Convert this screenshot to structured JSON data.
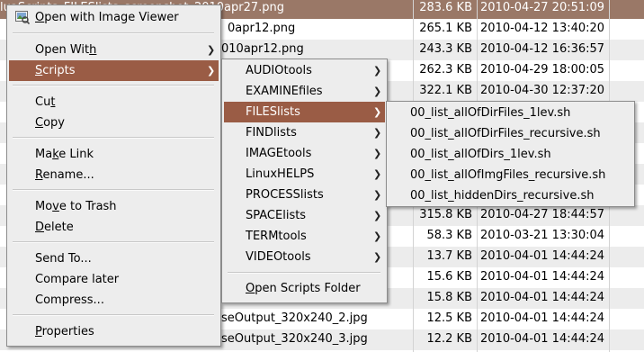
{
  "file_list": {
    "rows": [
      {
        "name": "luaScripts_FILESlists_screenshot_2010apr27.png",
        "size": "283.6 KB",
        "date": "2010-04-27 20:51:09"
      },
      {
        "name": "0apr12.png",
        "size": "265.1 KB",
        "date": "2010-04-12 13:40:20"
      },
      {
        "name": "010apr12.png",
        "size": "243.3 KB",
        "date": "2010-04-12 16:36:57"
      },
      {
        "name": "",
        "size": "262.3 KB",
        "date": "2010-04-29 18:00:05"
      },
      {
        "name": "",
        "size": "322.1 KB",
        "date": "2010-04-30 12:37:20"
      },
      {
        "name": "",
        "size": "",
        "date": ""
      },
      {
        "name": "",
        "size": "",
        "date": ""
      },
      {
        "name": "",
        "size": "",
        "date": ""
      },
      {
        "name": "",
        "size": "",
        "date": ""
      },
      {
        "name": "",
        "size": "",
        "date": ""
      },
      {
        "name": "",
        "size": "315.8 KB",
        "date": "2010-04-27 18:44:57"
      },
      {
        "name": "",
        "size": "58.3 KB",
        "date": "2010-03-21 13:30:04"
      },
      {
        "name": "",
        "size": "13.7 KB",
        "date": "2010-04-01 14:44:24"
      },
      {
        "name": "",
        "size": "15.6 KB",
        "date": "2010-04-01 14:44:24"
      },
      {
        "name": "",
        "size": "15.8 KB",
        "date": "2010-04-01 14:44:24"
      },
      {
        "name": "seOutput_320x240_2.jpg",
        "size": "12.5 KB",
        "date": "2010-04-01 14:44:24"
      },
      {
        "name": "seOutput_320x240_3.jpg",
        "size": "12.2 KB",
        "date": "2010-04-01 14:44:24"
      }
    ]
  },
  "context_menu": {
    "open_with_viewer": {
      "pre": "",
      "ul": "O",
      "post": "pen with Image Viewer"
    },
    "open_with": {
      "pre": "Open Wit",
      "ul": "h",
      "post": ""
    },
    "scripts": {
      "pre": "",
      "ul": "S",
      "post": "cripts"
    },
    "cut": {
      "pre": "Cu",
      "ul": "t",
      "post": ""
    },
    "copy": {
      "pre": "",
      "ul": "C",
      "post": "opy"
    },
    "make_link": {
      "pre": "Ma",
      "ul": "k",
      "post": "e Link"
    },
    "rename": {
      "pre": "",
      "ul": "R",
      "post": "ename..."
    },
    "move_to_trash": {
      "pre": "Mo",
      "ul": "v",
      "post": "e to Trash"
    },
    "delete": {
      "pre": "",
      "ul": "D",
      "post": "elete"
    },
    "send_to": "Send To...",
    "compare_later": "Compare later",
    "compress": "Compress...",
    "properties": {
      "pre": "",
      "ul": "P",
      "post": "roperties"
    }
  },
  "scripts_menu": {
    "items": [
      "AUDIOtools",
      "EXAMINEfiles",
      "FILESlists",
      "FINDlists",
      "IMAGEtools",
      "LinuxHELPS",
      "PROCESSlists",
      "SPACElists",
      "TERMtools",
      "VIDEOtools"
    ],
    "open_folder": {
      "pre": "",
      "ul": "O",
      "post": "pen Scripts Folder"
    }
  },
  "fileslists_menu": {
    "items": [
      "00_list_allOfDirFiles_1lev.sh",
      "00_list_allOfDirFiles_recursive.sh",
      "00_list_allOfDirs_1lev.sh",
      "00_list_allOfImgFiles_recursive.sh",
      "00_list_hiddenDirs_recursive.sh"
    ]
  },
  "icons": {
    "submenu_arrow": "chevron-right-icon",
    "viewer": "image-viewer-icon"
  },
  "colors": {
    "highlight": "#9a5c45",
    "selected_row": "#9a7867",
    "menu_bg": "#ededed"
  }
}
